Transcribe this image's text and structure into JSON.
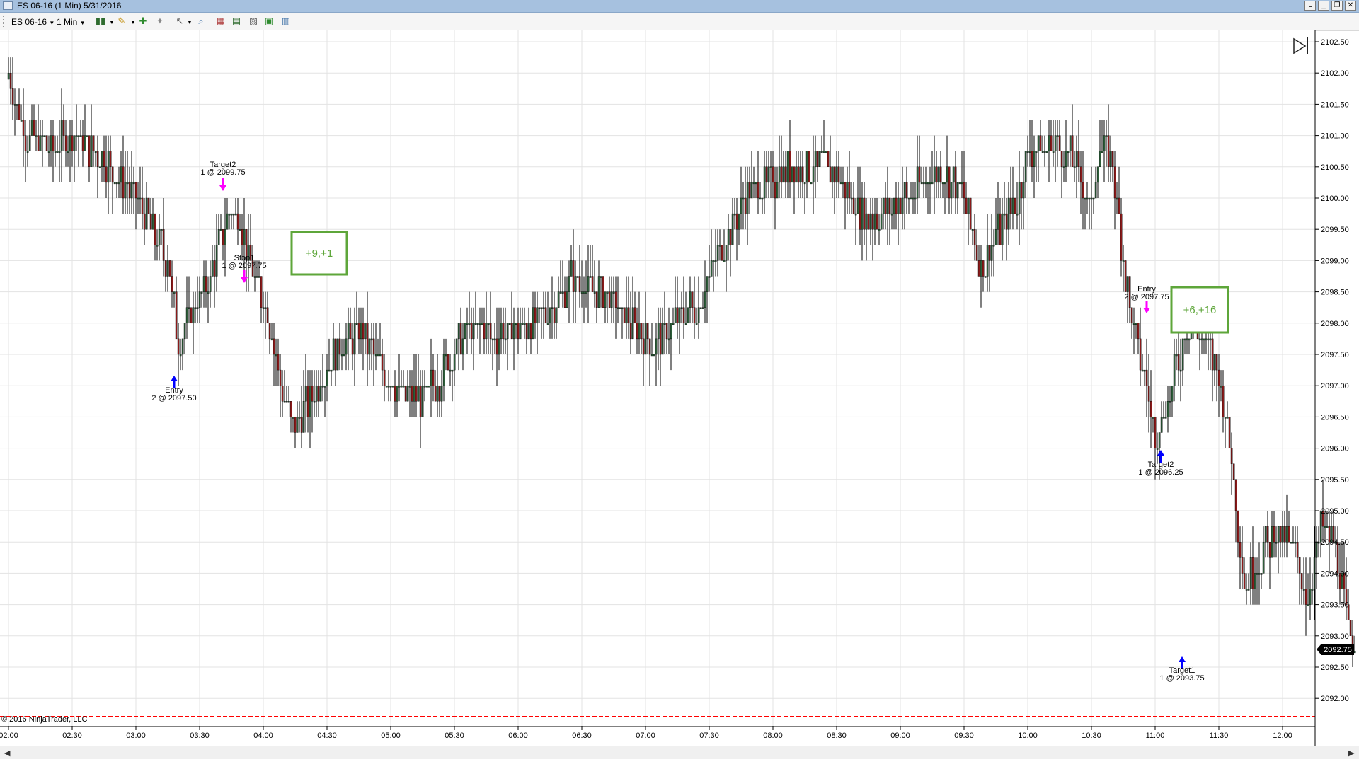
{
  "window": {
    "title": "ES 06-16 (1 Min)  5/31/2016",
    "buttons": [
      "L",
      "_",
      "❐",
      "✕"
    ]
  },
  "toolbar": {
    "instrument": "ES 06-16",
    "interval": "1 Min"
  },
  "chart": {
    "price_labels": [
      "2102.50",
      "2102.00",
      "2101.50",
      "2101.00",
      "2100.50",
      "2100.00",
      "2099.50",
      "2099.00",
      "2098.50",
      "2098.00",
      "2097.50",
      "2097.00",
      "2096.50",
      "2096.00",
      "2095.50",
      "2095.00",
      "2094.50",
      "2094.00",
      "2093.50",
      "2093.00",
      "2092.50",
      "2092.00"
    ],
    "time_labels": [
      "02:00",
      "02:30",
      "03:00",
      "03:30",
      "04:00",
      "04:30",
      "05:00",
      "05:30",
      "06:00",
      "06:30",
      "07:00",
      "07:30",
      "08:00",
      "08:30",
      "09:00",
      "09:30",
      "10:00",
      "10:30",
      "11:00",
      "11:30",
      "12:00"
    ],
    "last_price": "2092.75",
    "copyright": "© 2016 NinjaTrader, LLC",
    "colors": {
      "up": "#2e5e3a",
      "down": "#8b1a1a",
      "marker_exit": "#ff00ff",
      "marker_entry": "#0000ff",
      "box": "#5ea63a",
      "stop_line": "#ff0000"
    },
    "annotations": [
      {
        "id": "entry-1",
        "label": "Entry",
        "detail": "2 @ 2097.50"
      },
      {
        "id": "target2-1",
        "label": "Target2",
        "detail": "1 @ 2099.75"
      },
      {
        "id": "stop1",
        "label": "Stop1",
        "detail": "1 @ 2097.75"
      },
      {
        "id": "entry-2",
        "label": "Entry",
        "detail": "2 @ 2097.75"
      },
      {
        "id": "target2-2",
        "label": "Target2",
        "detail": "1 @ 2096.25"
      },
      {
        "id": "target1",
        "label": "Target1",
        "detail": "1 @ 2093.75"
      }
    ],
    "result_boxes": [
      "+9,+1",
      "+6,+16"
    ]
  }
}
